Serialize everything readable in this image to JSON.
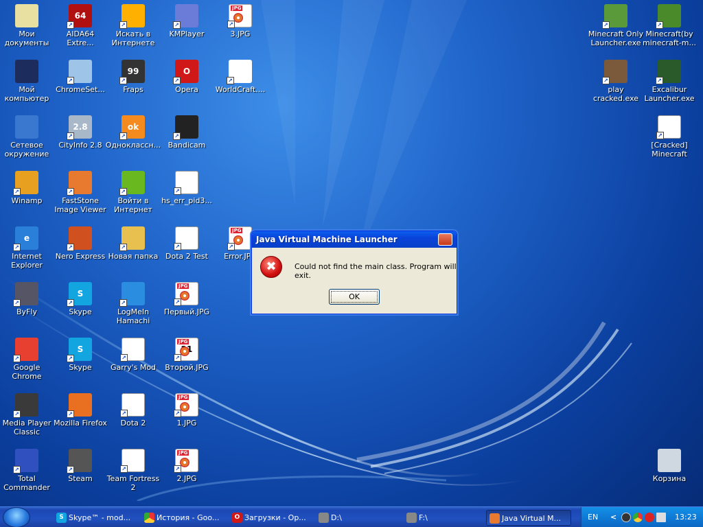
{
  "desktop": {
    "icons": [
      {
        "label": "Мои\nдокументы"
      },
      {
        "label": "AIDA64\nExtre..."
      },
      {
        "label": "Искать в\nИнтернете"
      },
      {
        "label": "KMPlayer"
      },
      {
        "label": "3.JPG"
      },
      {
        "label": "Мой\nкомпьютер"
      },
      {
        "label": "ChromeSet..."
      },
      {
        "label": "Fraps"
      },
      {
        "label": "Opera"
      },
      {
        "label": "WorldCraft...."
      },
      {
        "label": "Сетевое\nокружение"
      },
      {
        "label": "CityInfo 2.8"
      },
      {
        "label": "Одноклассн..."
      },
      {
        "label": "Bandicam"
      },
      {
        "label": "Winamp"
      },
      {
        "label": "FastStone\nImage Viewer"
      },
      {
        "label": "Войти в\nИнтернет"
      },
      {
        "label": "hs_err_pid3..."
      },
      {
        "label": "Internet\nExplorer"
      },
      {
        "label": "Nero Express"
      },
      {
        "label": "Новая папка"
      },
      {
        "label": "Dota 2 Test"
      },
      {
        "label": "Error.JPG"
      },
      {
        "label": "ByFly"
      },
      {
        "label": "Skype"
      },
      {
        "label": "LogMeIn\nHamachi"
      },
      {
        "label": "Первый.JPG"
      },
      {
        "label": "Google Chrome"
      },
      {
        "label": "Skype"
      },
      {
        "label": "Garry's Mod"
      },
      {
        "label": "Второй.JPG"
      },
      {
        "label": "Media Player\nClassic"
      },
      {
        "label": "Mozilla Firefox"
      },
      {
        "label": "Dota 2"
      },
      {
        "label": "1.JPG"
      },
      {
        "label": "Total\nCommander"
      },
      {
        "label": "Steam"
      },
      {
        "label": "Team Fortress\n2"
      },
      {
        "label": "2.JPG"
      },
      {
        "label": "Minecraft Only\nLauncher.exe"
      },
      {
        "label": "Minecraft(by\nminecraft-m..."
      },
      {
        "label": "play\ncracked.exe"
      },
      {
        "label": "Excalibur\nLauncher.exe"
      },
      {
        "label": "[Cracked]\nMinecraft"
      },
      {
        "label": "Корзина"
      }
    ],
    "icon_glyphs": [
      "",
      "64",
      "",
      "",
      "",
      "",
      "",
      "99",
      "O",
      "",
      "",
      "2.8",
      "ok",
      "",
      "",
      "",
      "",
      "",
      "e",
      "",
      "",
      "",
      "",
      "",
      "S",
      "",
      "",
      "",
      "S",
      "",
      "21",
      "",
      "",
      "",
      "",
      "",
      "",
      "",
      "",
      "",
      "",
      "",
      "",
      "",
      ""
    ]
  },
  "dialog": {
    "title": "Java Virtual Machine Launcher",
    "message": "Could not find the main class. Program will exit.",
    "ok_label": "OK",
    "error_glyph": "✖"
  },
  "taskbar": {
    "buttons": [
      {
        "label": "Skype™ - mod...",
        "glyph": "S"
      },
      {
        "label": "История - Goo...",
        "glyph": ""
      },
      {
        "label": "Загрузки - Op...",
        "glyph": "O"
      },
      {
        "label": "D:\\",
        "glyph": ""
      },
      {
        "label": "F:\\",
        "glyph": ""
      },
      {
        "label": "Java Virtual M...",
        "glyph": ""
      }
    ],
    "lang": "EN",
    "chevron": "<",
    "clock": "13:23"
  },
  "colors": {
    "accent": "#0a43d8",
    "desktop": "#1f63c9"
  }
}
